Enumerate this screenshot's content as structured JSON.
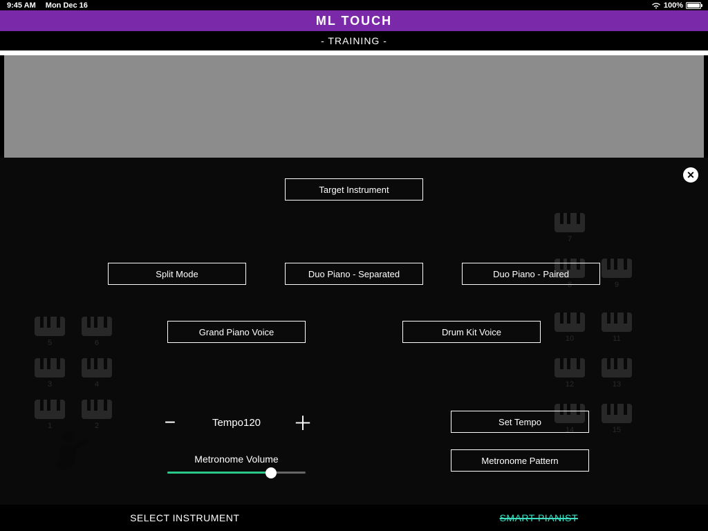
{
  "status": {
    "time": "9:45 AM",
    "date": "Mon Dec 16",
    "battery_pct": "100%"
  },
  "header": {
    "app_title": "ML TOUCH",
    "subtitle": "- TRAINING -"
  },
  "tiles": {
    "t1": "1",
    "t2": "2",
    "t3": "3",
    "t4": "4",
    "t5": "5",
    "t6": "6",
    "t7": "7",
    "t8": "8",
    "t9": "9",
    "t10": "10",
    "t11": "11",
    "t12": "12",
    "t13": "13",
    "t14": "14",
    "t15": "15"
  },
  "buttons": {
    "target_instrument": "Target Instrument",
    "split_mode": "Split Mode",
    "duo_separated": "Duo Piano - Separated",
    "duo_paired": "Duo Piano - Paired",
    "grand_piano": "Grand Piano Voice",
    "drum_kit": "Drum Kit Voice",
    "set_tempo": "Set Tempo",
    "metronome_pattern": "Metronome Pattern"
  },
  "tempo": {
    "label": "Tempo",
    "value": "120",
    "metronome_label": "Metronome Volume"
  },
  "bottom_nav": {
    "select_instrument": "SELECT INSTRUMENT",
    "smart_pianist": "SMART PIANIST"
  },
  "icons": {
    "close": "✕",
    "minus": "−",
    "plus": "＋",
    "wifi": "wifi"
  }
}
